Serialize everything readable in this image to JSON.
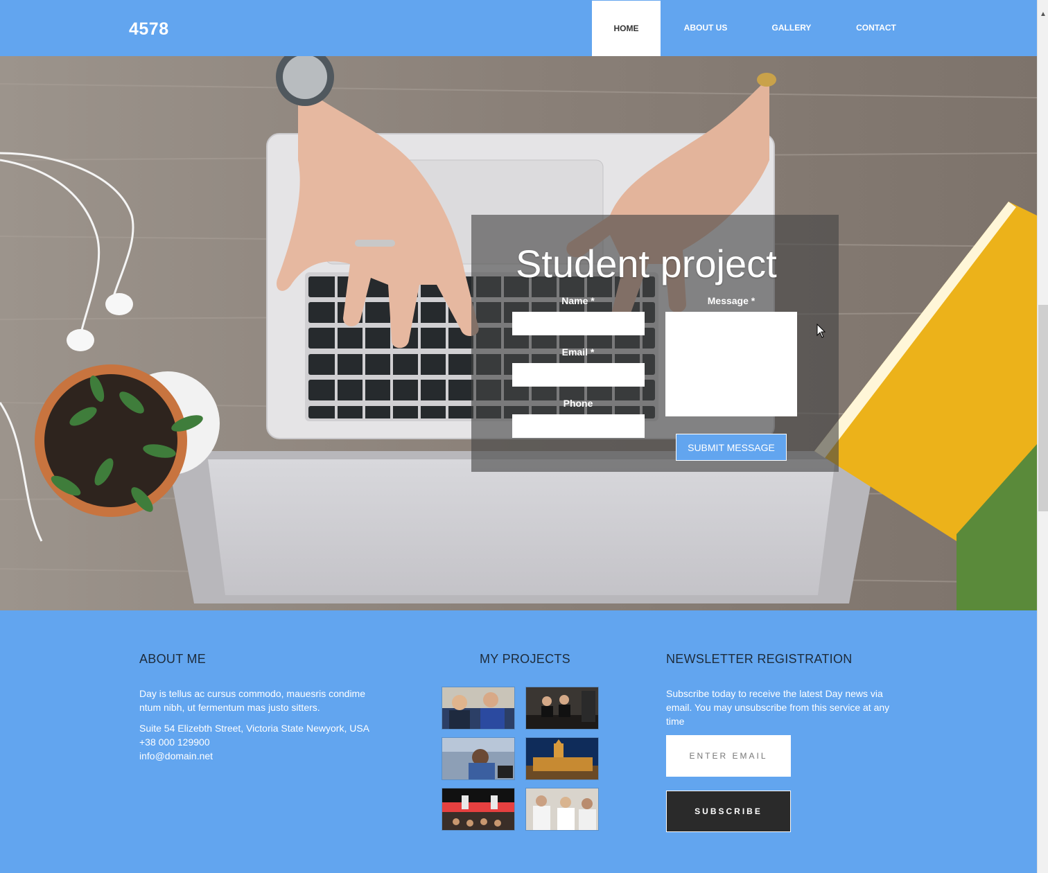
{
  "header": {
    "brand": "4578",
    "nav": [
      {
        "label": "HOME",
        "active": true
      },
      {
        "label": "ABOUT US",
        "active": false
      },
      {
        "label": "GALLERY",
        "active": false
      },
      {
        "label": "CONTACT",
        "active": false
      }
    ]
  },
  "hero": {
    "title": "Student project",
    "form": {
      "name_label": "Name *",
      "email_label": "Email *",
      "phone_label": "Phone",
      "message_label": "Message *",
      "submit_label": "SUBMIT MESSAGE"
    }
  },
  "footer": {
    "about": {
      "title": "ABOUT ME",
      "text": "Day is tellus ac cursus commodo, mauesris condime ntum nibh, ut fermentum mas justo sitters.",
      "address": "Suite 54 Elizebth Street, Victoria State Newyork, USA",
      "phone": "+38 000 129900",
      "email": "info@domain.net"
    },
    "projects": {
      "title": "MY PROJECTS",
      "thumbnails": [
        "project-1",
        "project-2",
        "project-3",
        "project-4",
        "project-5",
        "project-6"
      ]
    },
    "newsletter": {
      "title": "NEWSLETTER REGISTRATION",
      "text": "Subscribe today to receive the latest Day news via email. You may unsubscribe from this service at any time",
      "email_placeholder": "ENTER EMAIL",
      "subscribe_label": "SUBSCRIBE"
    }
  },
  "colors": {
    "accent": "#62a5ef",
    "dark_button": "#2a2a2a",
    "title_text": "#1d2b3a"
  }
}
